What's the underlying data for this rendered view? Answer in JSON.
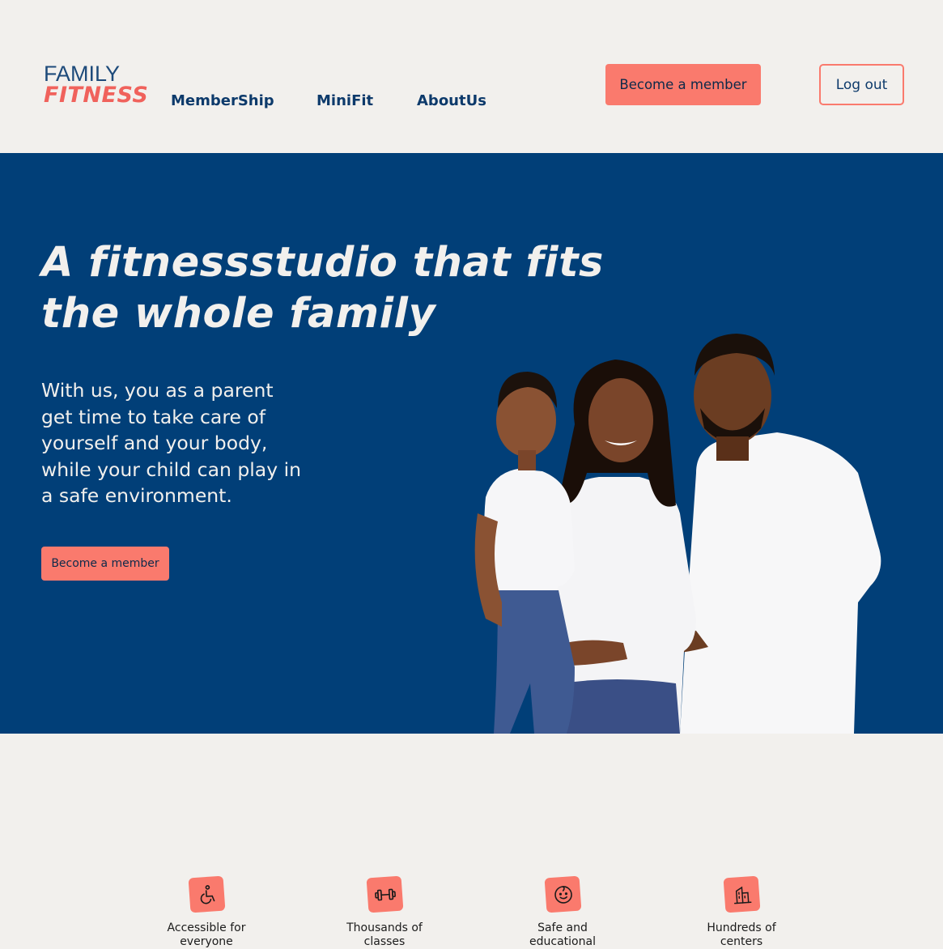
{
  "header": {
    "logo": {
      "line1": "FAMILY",
      "line2": "FITNESS"
    },
    "nav": [
      {
        "label": "MemberShip"
      },
      {
        "label": "MiniFit"
      },
      {
        "label": "AboutUs"
      }
    ],
    "become_member_label": "Become a member",
    "logout_label": "Log out"
  },
  "hero": {
    "title": "A fitnessstudio that fits the whole family",
    "text": "With us, you as a parent get time to take care of yourself and your body, while your child can play in a safe environment.",
    "cta_label": "Become a member",
    "image_icon": "family-photo"
  },
  "features": [
    {
      "icon": "wheelchair-icon",
      "label": "Accessible for everyone"
    },
    {
      "icon": "dumbbell-icon",
      "label": "Thousands of classes"
    },
    {
      "icon": "child-face-icon",
      "label": "Safe and educational"
    },
    {
      "icon": "building-icon",
      "label": "Hundreds of centers"
    }
  ],
  "colors": {
    "navy": "#013f78",
    "coral": "#fa7a6d",
    "background": "#f2f0ed"
  }
}
